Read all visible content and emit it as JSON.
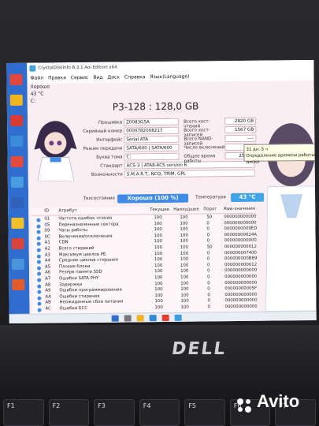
{
  "window": {
    "title": "CrystalDiskInfo 8.3.1 Aoi Edition x64",
    "menu": [
      "Файл",
      "Правка",
      "Сервис",
      "Вид",
      "Диск",
      "Справка",
      "Язык(Language)"
    ]
  },
  "drive_tab": {
    "status": "Хорошо",
    "temp": "43 °C",
    "letter": "C:"
  },
  "disk_title": "P3-128 : 128,0 GB",
  "info_left": [
    {
      "label": "Прошивка",
      "value": "Z0083G5A"
    },
    {
      "label": "Серийный номер",
      "value": "0000782008217"
    },
    {
      "label": "Интерфейс",
      "value": "Serial ATA"
    },
    {
      "label": "Режим передачи",
      "value": "SATA/600 | SATA/600"
    },
    {
      "label": "Буква тома",
      "value": "C:"
    },
    {
      "label": "Стандарт",
      "value": "ACS-3 | ATA8-ACS version 6"
    },
    {
      "label": "Возможности",
      "value": "S.M.A.R.T., NCQ, TRIM, GPL"
    }
  ],
  "info_right": [
    {
      "label": "Всего хост-чтений",
      "value": "2820 GB"
    },
    {
      "label": "Всего хост-записей",
      "value": "1567 GB"
    },
    {
      "label": "Всего NAND-записей",
      "value": "----"
    },
    {
      "label": "Число включений",
      "value": ""
    },
    {
      "label": "Общее время работы",
      "value": "2549 ч"
    }
  ],
  "health": {
    "label": "Техсостояние",
    "value": "Хорошо (100 %)"
  },
  "temperature": {
    "label": "Температура",
    "value": "43 °C"
  },
  "tooltip": {
    "line1": "31 дн. 5 ч",
    "line2": "Определение времени работы диско"
  },
  "table": {
    "headers": [
      "ID",
      "Атрибут",
      "Текущее",
      "Наихудшее",
      "Порог",
      "Raw-значения"
    ],
    "rows": [
      [
        "01",
        "Частота ошибок чтения",
        "100",
        "100",
        "50",
        "000000000000"
      ],
      [
        "05",
        "Переназначенные сектора",
        "100",
        "100",
        "0",
        "000000000000"
      ],
      [
        "09",
        "Часы работы",
        "100",
        "100",
        "0",
        "0000000009ED"
      ],
      [
        "0C",
        "Включения/отключения",
        "100",
        "100",
        "0",
        "00000000024A"
      ],
      [
        "A1",
        "CDN",
        "100",
        "100",
        "0",
        "000000000000"
      ],
      [
        "A2",
        "Всего стираний",
        "100",
        "100",
        "50",
        "000000000012"
      ],
      [
        "A3",
        "Максимум циклов PE",
        "100",
        "100",
        "0",
        "000000007400"
      ],
      [
        "A4",
        "Средние циклов стирания",
        "100",
        "100",
        "0",
        "000000000B89"
      ],
      [
        "A5",
        "Плохие блоки",
        "100",
        "100",
        "0",
        "000000000012"
      ],
      [
        "A6",
        "Резерв памяти SSD",
        "100",
        "100",
        "0",
        "000000000000"
      ],
      [
        "A7",
        "Ошибки SATA PHY",
        "100",
        "100",
        "0",
        "000000000000"
      ],
      [
        "A8",
        "Задержки",
        "100",
        "100",
        "0",
        "000000000000"
      ],
      [
        "A9",
        "Ошибки программирования",
        "100",
        "100",
        "0",
        "00000000005F"
      ],
      [
        "AA",
        "Ошибки стирания",
        "100",
        "100",
        "0",
        "000000000000"
      ],
      [
        "AB",
        "Неожиданные сбои питания",
        "100",
        "100",
        "0",
        "000000000000"
      ],
      [
        "AC",
        "Ошибки ECC",
        "100",
        "100",
        "0",
        "000000000000"
      ]
    ]
  },
  "laptop": {
    "brand": "DELL",
    "keys": [
      "F1",
      "F2",
      "F3",
      "F4",
      "F5",
      "F6",
      "F7"
    ],
    "watermark": "Avito"
  },
  "colors": {
    "accent": "#3f8be8",
    "desktop": "#2f6dcf",
    "window_bg": "#fbeef3"
  }
}
